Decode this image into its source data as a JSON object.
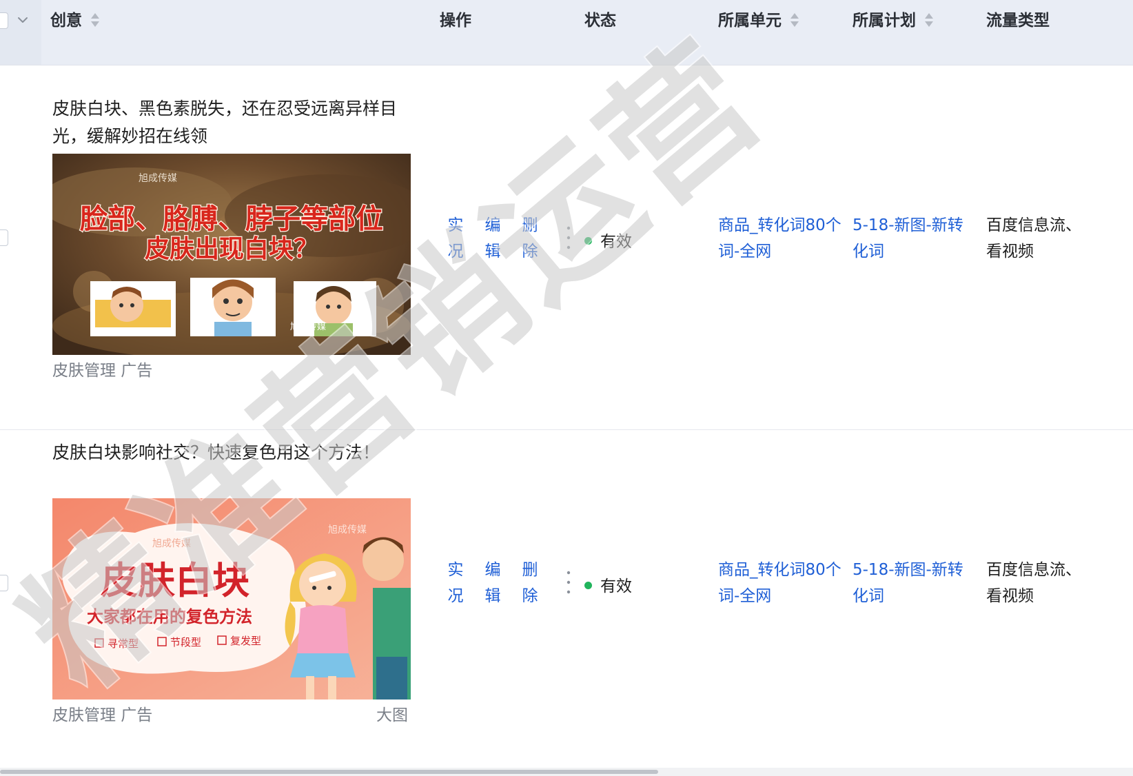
{
  "table": {
    "columns": [
      {
        "label": "创意",
        "sortable": true
      },
      {
        "label": "操作",
        "sortable": false
      },
      {
        "label": "状态",
        "sortable": false
      },
      {
        "label": "所属单元",
        "sortable": true
      },
      {
        "label": "所属计划",
        "sortable": true
      },
      {
        "label": "流量类型",
        "sortable": false
      }
    ],
    "rows": [
      {
        "title": "皮肤白块、黑色素脱失，还在忍受远离异样目光，缓解妙招在线领",
        "image": {
          "brand": "旭成传媒",
          "headline_line1": "脸部、胳膊、脖子等部位",
          "headline_line2": "皮肤出现白块？"
        },
        "meta_left": "皮肤管理 广告",
        "meta_right": "",
        "ops": [
          "实况",
          "编辑",
          "删除"
        ],
        "status": "有效",
        "unit": "商品_转化词80个词-全网",
        "plan": "5-18-新图-新转化词",
        "traffic": "百度信息流、看视频"
      },
      {
        "title": "皮肤白块影响社交？快速复色用这个方法！",
        "image": {
          "brand": "旭成传媒",
          "headline": "皮肤白块",
          "subheadline": "大家都在用的复色方法",
          "tags": [
            "寻常型",
            "节段型",
            "复发型"
          ]
        },
        "meta_left": "皮肤管理 广告",
        "meta_right": "大图",
        "ops": [
          "实况",
          "编辑",
          "删除"
        ],
        "status": "有效",
        "unit": "商品_转化词80个词-全网",
        "plan": "5-18-新图-新转化词",
        "traffic": "百度信息流、看视频"
      }
    ]
  },
  "watermark": "精准营销运营",
  "colors": {
    "header_bg": "#e9edf5",
    "link": "#1f5fd6",
    "status_ok": "#21b45c"
  },
  "icons": [
    "chevron-down-icon",
    "sort-icon",
    "more-icon",
    "checkbox"
  ]
}
